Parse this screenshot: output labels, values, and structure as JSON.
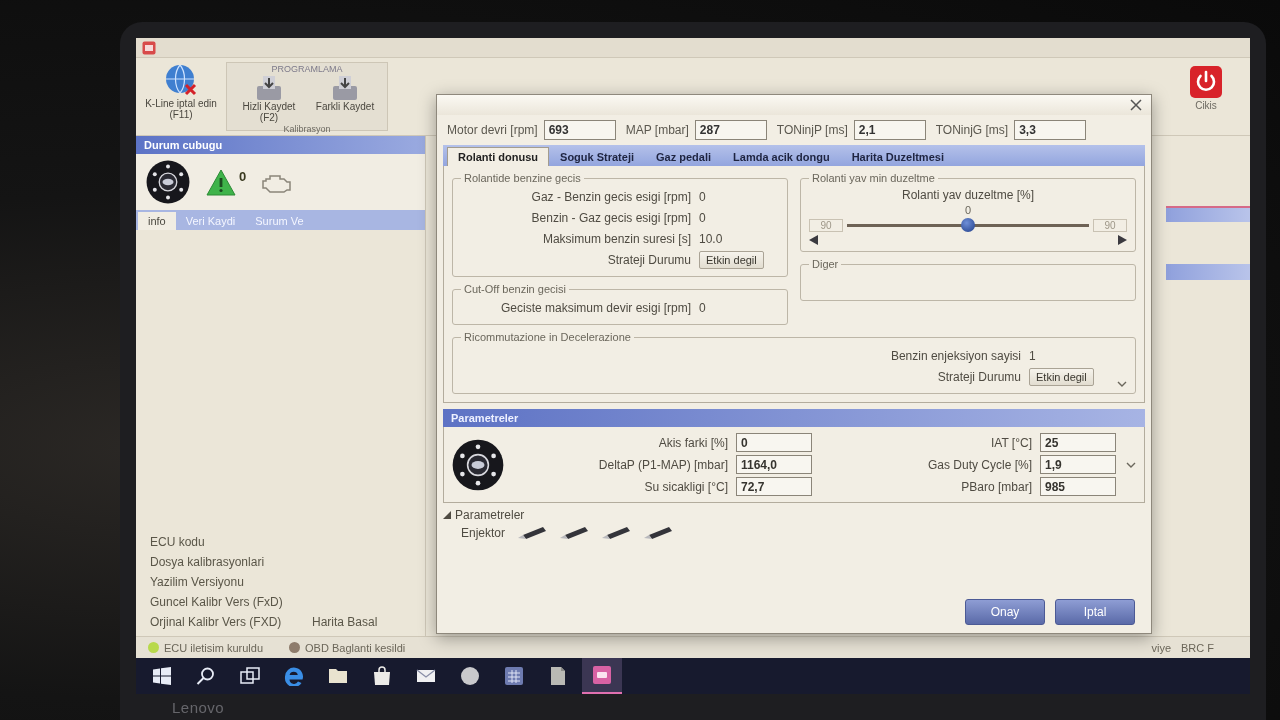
{
  "laptop": {
    "brand": "Lenovo"
  },
  "main_window": {
    "toolbar": {
      "kline_button": "K-Line iptal edin (F11)",
      "programming": {
        "title": "PROGRAMLAMA",
        "buttons": [
          "Hizli Kaydet (F2)",
          "Farkli Kaydet"
        ],
        "caption": "Kalibrasyon"
      },
      "exit_button": "Cikis"
    },
    "status_panel": {
      "title": "Durum cubugu",
      "warning_count": "0"
    },
    "info_tabs": [
      {
        "label": "info",
        "selected": true
      },
      {
        "label": "Veri Kaydi",
        "selected": false
      },
      {
        "label": "Surum Ve",
        "selected": false
      }
    ],
    "info_rows": [
      {
        "label": "ECU kodu"
      },
      {
        "label": "Dosya kalibrasyonlari"
      },
      {
        "label": "Yazilim Versiyonu"
      },
      {
        "label": "Guncel Kalibr Vers (FxD)"
      },
      {
        "label": "Orjinal Kalibr Vers (FXD)",
        "value": "Harita Basal"
      }
    ],
    "status_bar": [
      {
        "kind": "indicator",
        "text": "ECU iletisim kuruldu",
        "color": "#b8d94c"
      },
      {
        "kind": "indicator",
        "text": "OBD Baglanti kesildi",
        "color": "#8e7c6c"
      },
      {
        "kind": "text",
        "text": "viye"
      },
      {
        "kind": "text",
        "text": "BRC F"
      }
    ]
  },
  "dialog": {
    "readings": [
      {
        "label": "Motor devri [rpm]",
        "value": "693"
      },
      {
        "label": "MAP [mbar]",
        "value": "287"
      },
      {
        "label": "TONinjP [ms]",
        "value": "2,1"
      },
      {
        "label": "TONinjG [ms]",
        "value": "3,3"
      }
    ],
    "tabs": [
      {
        "label": "Rolanti donusu",
        "selected": true
      },
      {
        "label": "Soguk Strateji",
        "selected": false
      },
      {
        "label": "Gaz pedali",
        "selected": false
      },
      {
        "label": "Lamda acik dongu",
        "selected": false
      },
      {
        "label": "Harita Duzeltmesi",
        "selected": false
      }
    ],
    "idle_to_petrol": {
      "title": "Rolantide benzine gecis",
      "rows": [
        {
          "kind": "value",
          "label": "Gaz - Benzin gecis esigi [rpm]",
          "value": "0"
        },
        {
          "kind": "value",
          "label": "Benzin - Gaz gecis esigi [rpm]",
          "value": "0"
        },
        {
          "kind": "value",
          "label": "Maksimum benzin suresi [s]",
          "value": "10.0"
        },
        {
          "kind": "button",
          "label": "Strateji Durumu",
          "value": "Etkin degil"
        }
      ]
    },
    "cutoff": {
      "title": "Cut-Off benzin gecisi",
      "rows": [
        {
          "kind": "value",
          "label": "Geciste maksimum devir esigi [rpm]",
          "value": "0"
        }
      ]
    },
    "idle_correction": {
      "title": "Rolanti yav min duzeltme",
      "slider": {
        "label": "Rolanti yav duzeltme [%]",
        "value": "0",
        "min": "90",
        "max": "90",
        "level": 0.5
      }
    },
    "other": {
      "title": "Diger"
    },
    "deceleration": {
      "title": "Ricommutazione in Decelerazione",
      "rows": [
        {
          "kind": "value",
          "label": "Benzin enjeksiyon sayisi",
          "value": "1"
        },
        {
          "kind": "button",
          "label": "Strateji Durumu",
          "value": "Etkin degil"
        }
      ]
    },
    "parameters": {
      "title": "Parametreler",
      "readings": [
        {
          "label": "Akis farki [%]",
          "value": "0"
        },
        {
          "label": "DeltaP (P1-MAP) [mbar]",
          "value": "1164,0"
        },
        {
          "label": "Su sicakligi [°C]",
          "value": "72,7"
        },
        {
          "label": "IAT [°C]",
          "value": "25"
        },
        {
          "label": "Gas Duty Cycle [%]",
          "value": "1,9"
        },
        {
          "label": "PBaro [mbar]",
          "value": "985"
        }
      ]
    },
    "injector_section": {
      "title": "Parametreler",
      "label": "Enjektor",
      "injectors": [
        {
          "kind": "injector"
        },
        {
          "kind": "injector"
        },
        {
          "kind": "injector"
        },
        {
          "kind": "injector"
        }
      ]
    },
    "buttons": [
      "Onay",
      "Iptal"
    ]
  },
  "taskbar": {
    "icons": [
      {
        "kind": "start",
        "selected": false
      },
      {
        "kind": "search",
        "selected": false
      },
      {
        "kind": "task-view",
        "selected": false
      },
      {
        "kind": "browser",
        "selected": false
      },
      {
        "kind": "folder",
        "selected": false
      },
      {
        "kind": "store",
        "selected": false
      },
      {
        "kind": "mail",
        "selected": false
      },
      {
        "kind": "disc",
        "selected": false
      },
      {
        "kind": "grid-app",
        "selected": false
      },
      {
        "kind": "page-app",
        "selected": false
      },
      {
        "kind": "brc",
        "selected": true
      }
    ]
  }
}
